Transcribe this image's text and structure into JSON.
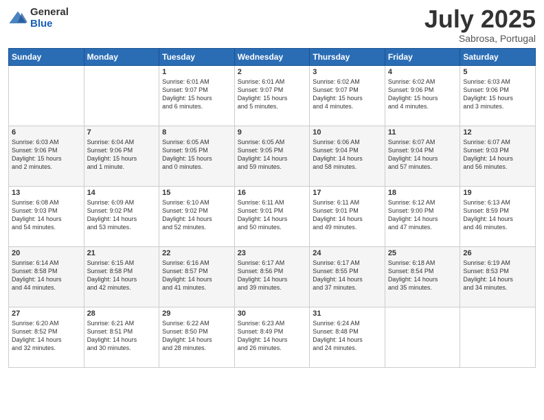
{
  "header": {
    "logo_general": "General",
    "logo_blue": "Blue",
    "month_title": "July 2025",
    "location": "Sabrosa, Portugal"
  },
  "weekdays": [
    "Sunday",
    "Monday",
    "Tuesday",
    "Wednesday",
    "Thursday",
    "Friday",
    "Saturday"
  ],
  "weeks": [
    [
      {
        "day": "",
        "detail": ""
      },
      {
        "day": "",
        "detail": ""
      },
      {
        "day": "1",
        "detail": "Sunrise: 6:01 AM\nSunset: 9:07 PM\nDaylight: 15 hours\nand 6 minutes."
      },
      {
        "day": "2",
        "detail": "Sunrise: 6:01 AM\nSunset: 9:07 PM\nDaylight: 15 hours\nand 5 minutes."
      },
      {
        "day": "3",
        "detail": "Sunrise: 6:02 AM\nSunset: 9:07 PM\nDaylight: 15 hours\nand 4 minutes."
      },
      {
        "day": "4",
        "detail": "Sunrise: 6:02 AM\nSunset: 9:06 PM\nDaylight: 15 hours\nand 4 minutes."
      },
      {
        "day": "5",
        "detail": "Sunrise: 6:03 AM\nSunset: 9:06 PM\nDaylight: 15 hours\nand 3 minutes."
      }
    ],
    [
      {
        "day": "6",
        "detail": "Sunrise: 6:03 AM\nSunset: 9:06 PM\nDaylight: 15 hours\nand 2 minutes."
      },
      {
        "day": "7",
        "detail": "Sunrise: 6:04 AM\nSunset: 9:06 PM\nDaylight: 15 hours\nand 1 minute."
      },
      {
        "day": "8",
        "detail": "Sunrise: 6:05 AM\nSunset: 9:05 PM\nDaylight: 15 hours\nand 0 minutes."
      },
      {
        "day": "9",
        "detail": "Sunrise: 6:05 AM\nSunset: 9:05 PM\nDaylight: 14 hours\nand 59 minutes."
      },
      {
        "day": "10",
        "detail": "Sunrise: 6:06 AM\nSunset: 9:04 PM\nDaylight: 14 hours\nand 58 minutes."
      },
      {
        "day": "11",
        "detail": "Sunrise: 6:07 AM\nSunset: 9:04 PM\nDaylight: 14 hours\nand 57 minutes."
      },
      {
        "day": "12",
        "detail": "Sunrise: 6:07 AM\nSunset: 9:03 PM\nDaylight: 14 hours\nand 56 minutes."
      }
    ],
    [
      {
        "day": "13",
        "detail": "Sunrise: 6:08 AM\nSunset: 9:03 PM\nDaylight: 14 hours\nand 54 minutes."
      },
      {
        "day": "14",
        "detail": "Sunrise: 6:09 AM\nSunset: 9:02 PM\nDaylight: 14 hours\nand 53 minutes."
      },
      {
        "day": "15",
        "detail": "Sunrise: 6:10 AM\nSunset: 9:02 PM\nDaylight: 14 hours\nand 52 minutes."
      },
      {
        "day": "16",
        "detail": "Sunrise: 6:11 AM\nSunset: 9:01 PM\nDaylight: 14 hours\nand 50 minutes."
      },
      {
        "day": "17",
        "detail": "Sunrise: 6:11 AM\nSunset: 9:01 PM\nDaylight: 14 hours\nand 49 minutes."
      },
      {
        "day": "18",
        "detail": "Sunrise: 6:12 AM\nSunset: 9:00 PM\nDaylight: 14 hours\nand 47 minutes."
      },
      {
        "day": "19",
        "detail": "Sunrise: 6:13 AM\nSunset: 8:59 PM\nDaylight: 14 hours\nand 46 minutes."
      }
    ],
    [
      {
        "day": "20",
        "detail": "Sunrise: 6:14 AM\nSunset: 8:58 PM\nDaylight: 14 hours\nand 44 minutes."
      },
      {
        "day": "21",
        "detail": "Sunrise: 6:15 AM\nSunset: 8:58 PM\nDaylight: 14 hours\nand 42 minutes."
      },
      {
        "day": "22",
        "detail": "Sunrise: 6:16 AM\nSunset: 8:57 PM\nDaylight: 14 hours\nand 41 minutes."
      },
      {
        "day": "23",
        "detail": "Sunrise: 6:17 AM\nSunset: 8:56 PM\nDaylight: 14 hours\nand 39 minutes."
      },
      {
        "day": "24",
        "detail": "Sunrise: 6:17 AM\nSunset: 8:55 PM\nDaylight: 14 hours\nand 37 minutes."
      },
      {
        "day": "25",
        "detail": "Sunrise: 6:18 AM\nSunset: 8:54 PM\nDaylight: 14 hours\nand 35 minutes."
      },
      {
        "day": "26",
        "detail": "Sunrise: 6:19 AM\nSunset: 8:53 PM\nDaylight: 14 hours\nand 34 minutes."
      }
    ],
    [
      {
        "day": "27",
        "detail": "Sunrise: 6:20 AM\nSunset: 8:52 PM\nDaylight: 14 hours\nand 32 minutes."
      },
      {
        "day": "28",
        "detail": "Sunrise: 6:21 AM\nSunset: 8:51 PM\nDaylight: 14 hours\nand 30 minutes."
      },
      {
        "day": "29",
        "detail": "Sunrise: 6:22 AM\nSunset: 8:50 PM\nDaylight: 14 hours\nand 28 minutes."
      },
      {
        "day": "30",
        "detail": "Sunrise: 6:23 AM\nSunset: 8:49 PM\nDaylight: 14 hours\nand 26 minutes."
      },
      {
        "day": "31",
        "detail": "Sunrise: 6:24 AM\nSunset: 8:48 PM\nDaylight: 14 hours\nand 24 minutes."
      },
      {
        "day": "",
        "detail": ""
      },
      {
        "day": "",
        "detail": ""
      }
    ]
  ]
}
